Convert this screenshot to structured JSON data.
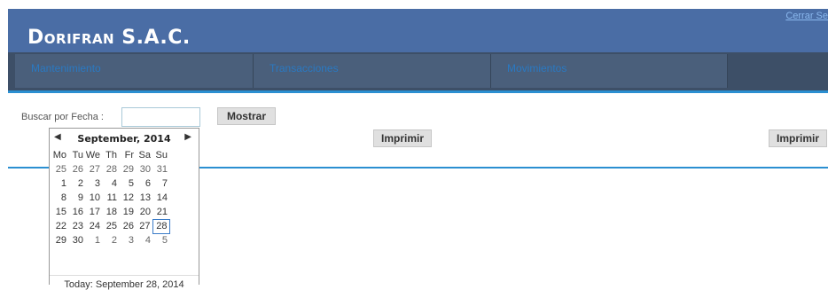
{
  "header": {
    "brand": "Dorifran S.A.C.",
    "logout_link": "Cerrar Se"
  },
  "nav": {
    "items": [
      {
        "label": "Mantenimiento"
      },
      {
        "label": "Transacciones"
      },
      {
        "label": "Movimientos"
      }
    ]
  },
  "search": {
    "label": "Buscar por Fecha :",
    "value": "",
    "show_button": "Mostrar",
    "print_button_1": "Imprimir",
    "print_button_2": "Imprimir"
  },
  "calendar": {
    "month_title": "September, 2014",
    "weekdays": [
      "Mo",
      "Tu",
      "We",
      "Th",
      "Fr",
      "Sa",
      "Su"
    ],
    "weeks": [
      [
        "25",
        "26",
        "27",
        "28",
        "29",
        "30",
        "31"
      ],
      [
        "1",
        "2",
        "3",
        "4",
        "5",
        "6",
        "7"
      ],
      [
        "8",
        "9",
        "10",
        "11",
        "12",
        "13",
        "14"
      ],
      [
        "15",
        "16",
        "17",
        "18",
        "19",
        "20",
        "21"
      ],
      [
        "22",
        "23",
        "24",
        "25",
        "26",
        "27",
        "28"
      ],
      [
        "29",
        "30",
        "1",
        "2",
        "3",
        "4",
        "5"
      ]
    ],
    "today_label": "Today: September 28, 2014"
  },
  "colors": {
    "header_bg": "#4a6da5",
    "nav_bg": "#3d4f67",
    "nav_text": "#2a79c2",
    "accent_line": "#2b8fd1"
  }
}
